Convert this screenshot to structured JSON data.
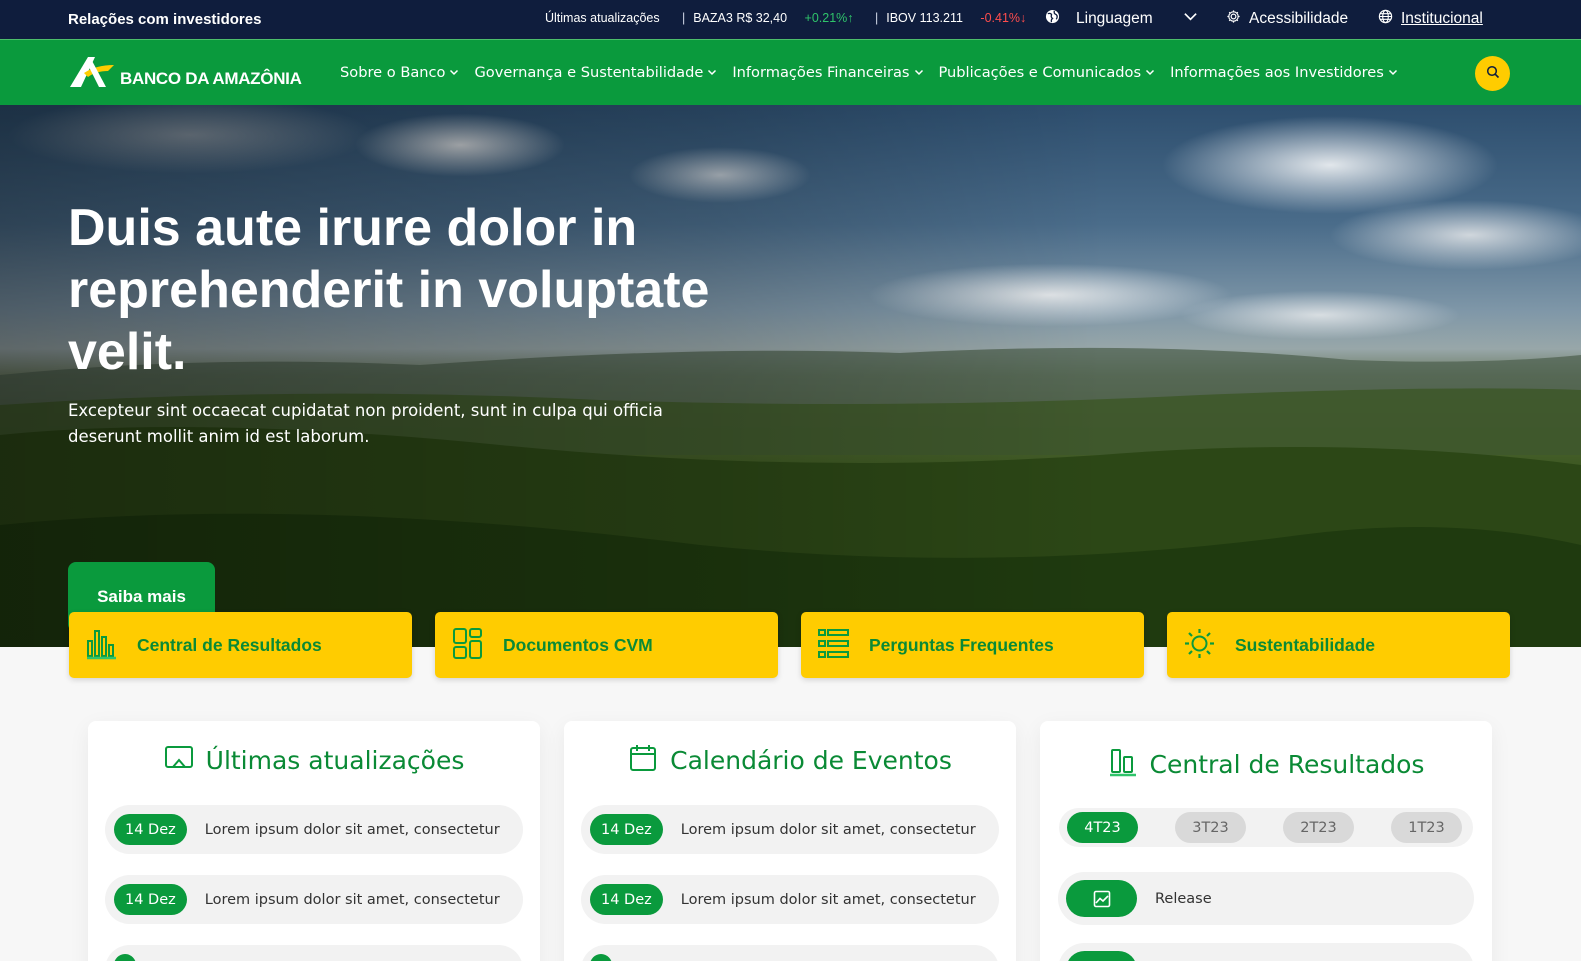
{
  "topbar": {
    "brand": "Relações com investidores",
    "ticker_title": "Últimas atualizações",
    "baza": {
      "label": "BAZA3 R$ 32,40",
      "change": "+0.21%↑"
    },
    "ibov": {
      "label": "IBOV 113.211",
      "change": "-0.41%↓"
    },
    "language": "Linguagem",
    "accessibility": "Acessibilidade",
    "institutional": "Institucional"
  },
  "nav": {
    "logo_text": "BANCO DA AMAZÔNIA",
    "items": [
      {
        "label": "Sobre o Banco"
      },
      {
        "label": "Governança e Sustentabilidade"
      },
      {
        "label": "Informações Financeiras"
      },
      {
        "label": "Publicações e Comunicados"
      },
      {
        "label": "Informações aos Investidores"
      }
    ]
  },
  "hero": {
    "title": "Duis aute irure dolor in reprehenderit in voluptate velit.",
    "subtitle": "Excepteur sint occaecat cupidatat non proident, sunt in culpa qui officia deserunt mollit anim id est laborum.",
    "cta": "Saiba mais"
  },
  "quick_links": [
    {
      "label": "Central de Resultados",
      "icon": "bar-chart-icon"
    },
    {
      "label": "Documentos CVM",
      "icon": "dashboard-grid-icon"
    },
    {
      "label": "Perguntas Frequentes",
      "icon": "list-icon"
    },
    {
      "label": "Sustentabilidade",
      "icon": "sun-icon"
    }
  ],
  "updates": {
    "title": "Últimas atualizações",
    "items": [
      {
        "date": "14 Dez",
        "text": "Lorem ipsum dolor sit amet, consectetur"
      },
      {
        "date": "14 Dez",
        "text": "Lorem ipsum dolor sit amet, consectetur"
      }
    ]
  },
  "events": {
    "title": "Calendário de Eventos",
    "items": [
      {
        "date": "14 Dez",
        "text": "Lorem ipsum dolor sit amet, consectetur"
      },
      {
        "date": "14 Dez",
        "text": "Lorem ipsum dolor sit amet, consectetur"
      }
    ]
  },
  "results": {
    "title": "Central de Resultados",
    "periods": [
      "4T23",
      "3T23",
      "2T23",
      "1T23"
    ],
    "active_period": "4T23",
    "items": [
      {
        "label": "Release",
        "icon": "image-icon"
      }
    ]
  },
  "colors": {
    "navy": "#0f1d3d",
    "green": "#0a9a3d",
    "yellow": "#ffcc00",
    "up": "#2fc46a",
    "down": "#ff4d4d"
  }
}
